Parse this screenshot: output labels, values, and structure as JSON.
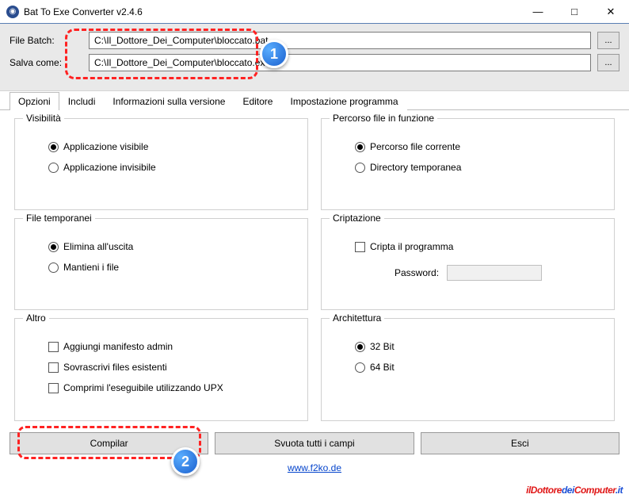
{
  "window": {
    "title": "Bat To Exe Converter v2.4.6"
  },
  "fields": {
    "file_batch_label": "File Batch:",
    "file_batch_value": "C:\\Il_Dottore_Dei_Computer\\bloccato.bat",
    "save_as_label": "Salva come:",
    "save_as_value": "C:\\Il_Dottore_Dei_Computer\\bloccato.exe",
    "browse": "..."
  },
  "tabs": {
    "options": "Opzioni",
    "includes": "Includi",
    "version": "Informazioni sulla versione",
    "editor": "Editore",
    "program": "Impostazione programma"
  },
  "groups": {
    "visibility": {
      "legend": "Visibilità",
      "visible": "Applicazione visibile",
      "invisible": "Applicazione invisibile"
    },
    "tempfiles": {
      "legend": "File temporanei",
      "delete": "Elimina all'uscita",
      "keep": "Mantieni i file"
    },
    "other": {
      "legend": "Altro",
      "admin": "Aggiungi manifesto admin",
      "overwrite": "Sovrascrivi files esistenti",
      "upx": "Comprimi l'eseguibile utilizzando UPX"
    },
    "workingdir": {
      "legend": "Percorso file in funzione",
      "current": "Percorso file corrente",
      "temp": "Directory temporanea"
    },
    "encrypt": {
      "legend": "Criptazione",
      "encrypt": "Cripta il programma",
      "pwd_label": "Password:"
    },
    "arch": {
      "legend": "Architettura",
      "b32": "32 Bit",
      "b64": "64 Bit"
    }
  },
  "buttons": {
    "compile": "Compilar",
    "clear": "Svuota tutti i campi",
    "exit": "Esci"
  },
  "footer": {
    "link": "www.f2ko.de"
  },
  "badges": {
    "one": "1",
    "two": "2"
  },
  "watermark": {
    "a": "ilDottore",
    "b": "dei",
    "c": "Computer",
    "d": ".it"
  }
}
